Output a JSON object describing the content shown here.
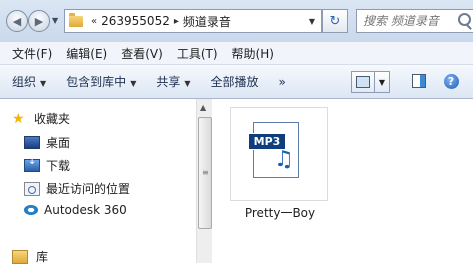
{
  "address": {
    "overflow": "«",
    "segments": [
      "263955052",
      "频道录音"
    ],
    "separator": "▸"
  },
  "search": {
    "placeholder": "搜索 频道录音"
  },
  "menu": [
    "文件(F)",
    "编辑(E)",
    "查看(V)",
    "工具(T)",
    "帮助(H)"
  ],
  "commands": {
    "organize": "组织",
    "include_library": "包含到库中",
    "share": "共享",
    "play_all": "全部播放",
    "more": "»"
  },
  "nav": {
    "favorites": "收藏夹",
    "desktop": "桌面",
    "downloads": "下载",
    "recent": "最近访问的位置",
    "autodesk": "Autodesk 360",
    "libraries": "库"
  },
  "files": [
    {
      "name": "Pretty一Boy",
      "type_label": "MP3",
      "icon": "mp3-file-icon"
    }
  ],
  "colors": {
    "accent": "#1b5fae",
    "chrome": "#dbe6f3"
  }
}
